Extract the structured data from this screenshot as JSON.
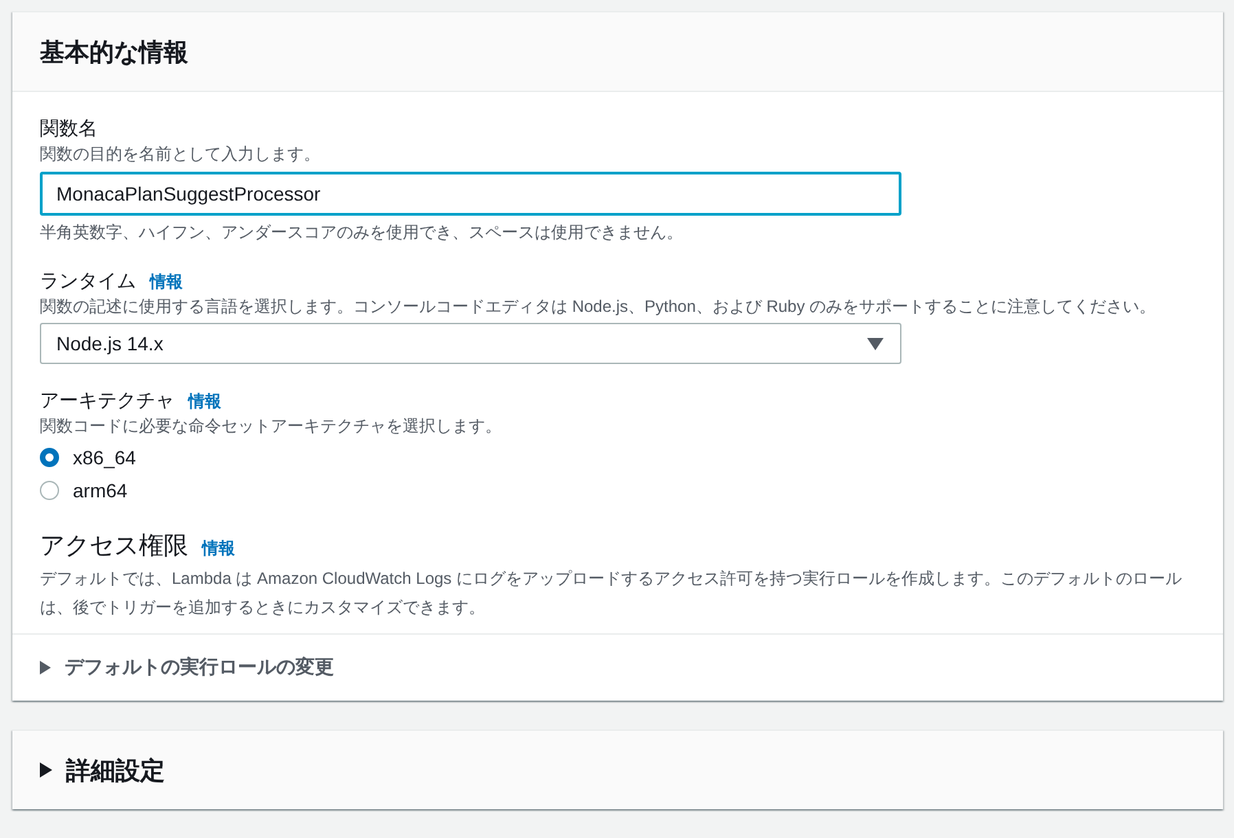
{
  "basic_panel": {
    "title": "基本的な情報",
    "function_name": {
      "label": "関数名",
      "description": "関数の目的を名前として入力します。",
      "value": "MonacaPlanSuggestProcessor",
      "focused": true,
      "hint": "半角英数字、ハイフン、アンダースコアのみを使用でき、スペースは使用できません。"
    },
    "runtime": {
      "label": "ランタイム",
      "info": "情報",
      "description": "関数の記述に使用する言語を選択します。コンソールコードエディタは Node.js、Python、および Ruby のみをサポートすることに注意してください。",
      "value": "Node.js 14.x"
    },
    "architecture": {
      "label": "アーキテクチャ",
      "info": "情報",
      "description": "関数コードに必要な命令セットアーキテクチャを選択します。",
      "options": [
        {
          "label": "x86_64",
          "selected": true
        },
        {
          "label": "arm64",
          "selected": false
        }
      ]
    },
    "permissions": {
      "title": "アクセス権限",
      "info": "情報",
      "description": "デフォルトでは、Lambda は Amazon CloudWatch Logs にログをアップロードするアクセス許可を持つ実行ロールを作成します。このデフォルトのロールは、後でトリガーを追加するときにカスタマイズできます。"
    },
    "role_expander": {
      "label": "デフォルトの実行ロールの変更",
      "expanded": false
    }
  },
  "advanced_panel": {
    "title": "詳細設定",
    "expanded": false
  }
}
